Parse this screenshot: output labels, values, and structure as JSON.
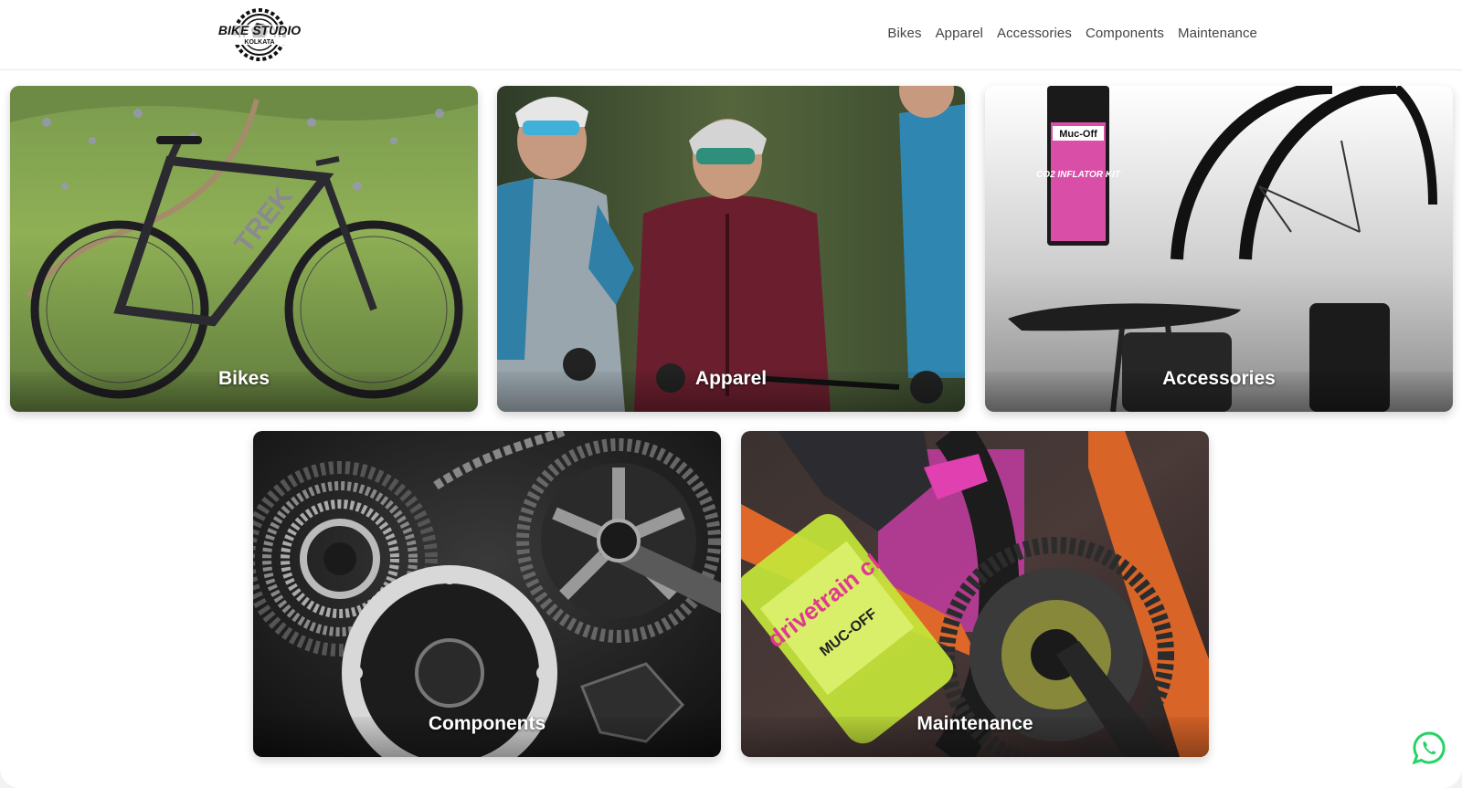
{
  "header": {
    "logo_text": "BIKE STUDIO",
    "logo_subtext": "KOLKATA",
    "nav": [
      {
        "label": "Bikes"
      },
      {
        "label": "Apparel"
      },
      {
        "label": "Accessories"
      },
      {
        "label": "Components"
      },
      {
        "label": "Maintenance"
      }
    ]
  },
  "categories": [
    {
      "label": "Bikes",
      "image": "mountain-bike-photo",
      "bike_brand_text": "TREK"
    },
    {
      "label": "Apparel",
      "image": "cyclists-in-jerseys-photo"
    },
    {
      "label": "Accessories",
      "image": "accessories-product-photo",
      "product_text": "Muc-Off",
      "product_subtext": "CO2 INFLATOR KIT"
    },
    {
      "label": "Components",
      "image": "drivetrain-components-photo"
    },
    {
      "label": "Maintenance",
      "image": "chain-cleaning-photo",
      "product_text": "drivetrain cl",
      "product_brand": "MUC-OFF"
    }
  ],
  "floating": {
    "whatsapp_icon": "whatsapp-icon",
    "whatsapp_color": "#25d366"
  },
  "colors": {
    "background": "#ffffff",
    "nav_text": "#444444",
    "caption_text": "#ffffff"
  }
}
